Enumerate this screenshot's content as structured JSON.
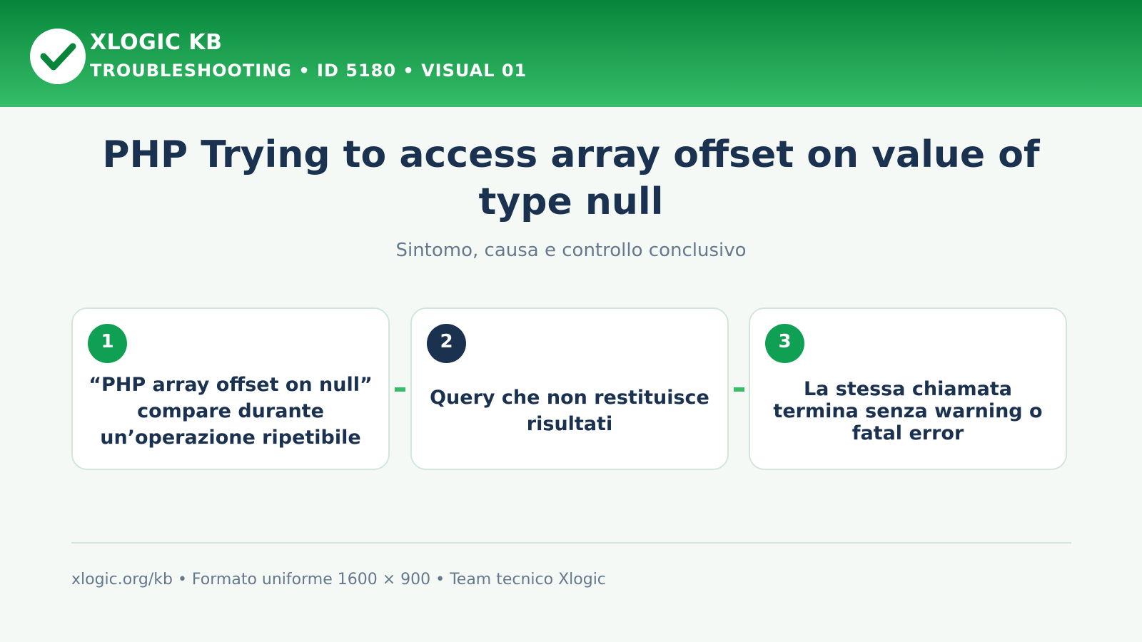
{
  "header": {
    "logo_icon": "check-circle-icon",
    "brand": "XLOGIC KB",
    "subbrand": "TROUBLESHOOTING • ID 5180 • VISUAL 01",
    "colors": {
      "gradient_top": "#07863b",
      "gradient_bottom": "#35bd68"
    }
  },
  "main": {
    "title": "PHP Trying to access array offset on value of type null",
    "subtitle": "Sintomo, causa e controllo conclusivo"
  },
  "steps": [
    {
      "number": "1",
      "text": "“PHP array offset on null” compare durante un’operazione ripetibile",
      "badge_color": "#10a053"
    },
    {
      "number": "2",
      "text": "Query che non restituisce risultati",
      "badge_color": "#1b3150"
    },
    {
      "number": "3",
      "text": "La stessa chiamata termina senza warning o fatal error",
      "badge_color": "#10a053"
    }
  ],
  "footer": {
    "text": "xlogic.org/kb • Formato uniforme 1600 × 900 • Team tecnico Xlogic"
  },
  "colors": {
    "background": "#f4f9f6",
    "text_primary": "#1b3150",
    "text_secondary": "#66788c",
    "accent": "#35bd68",
    "card_border": "#d3e6dc"
  }
}
